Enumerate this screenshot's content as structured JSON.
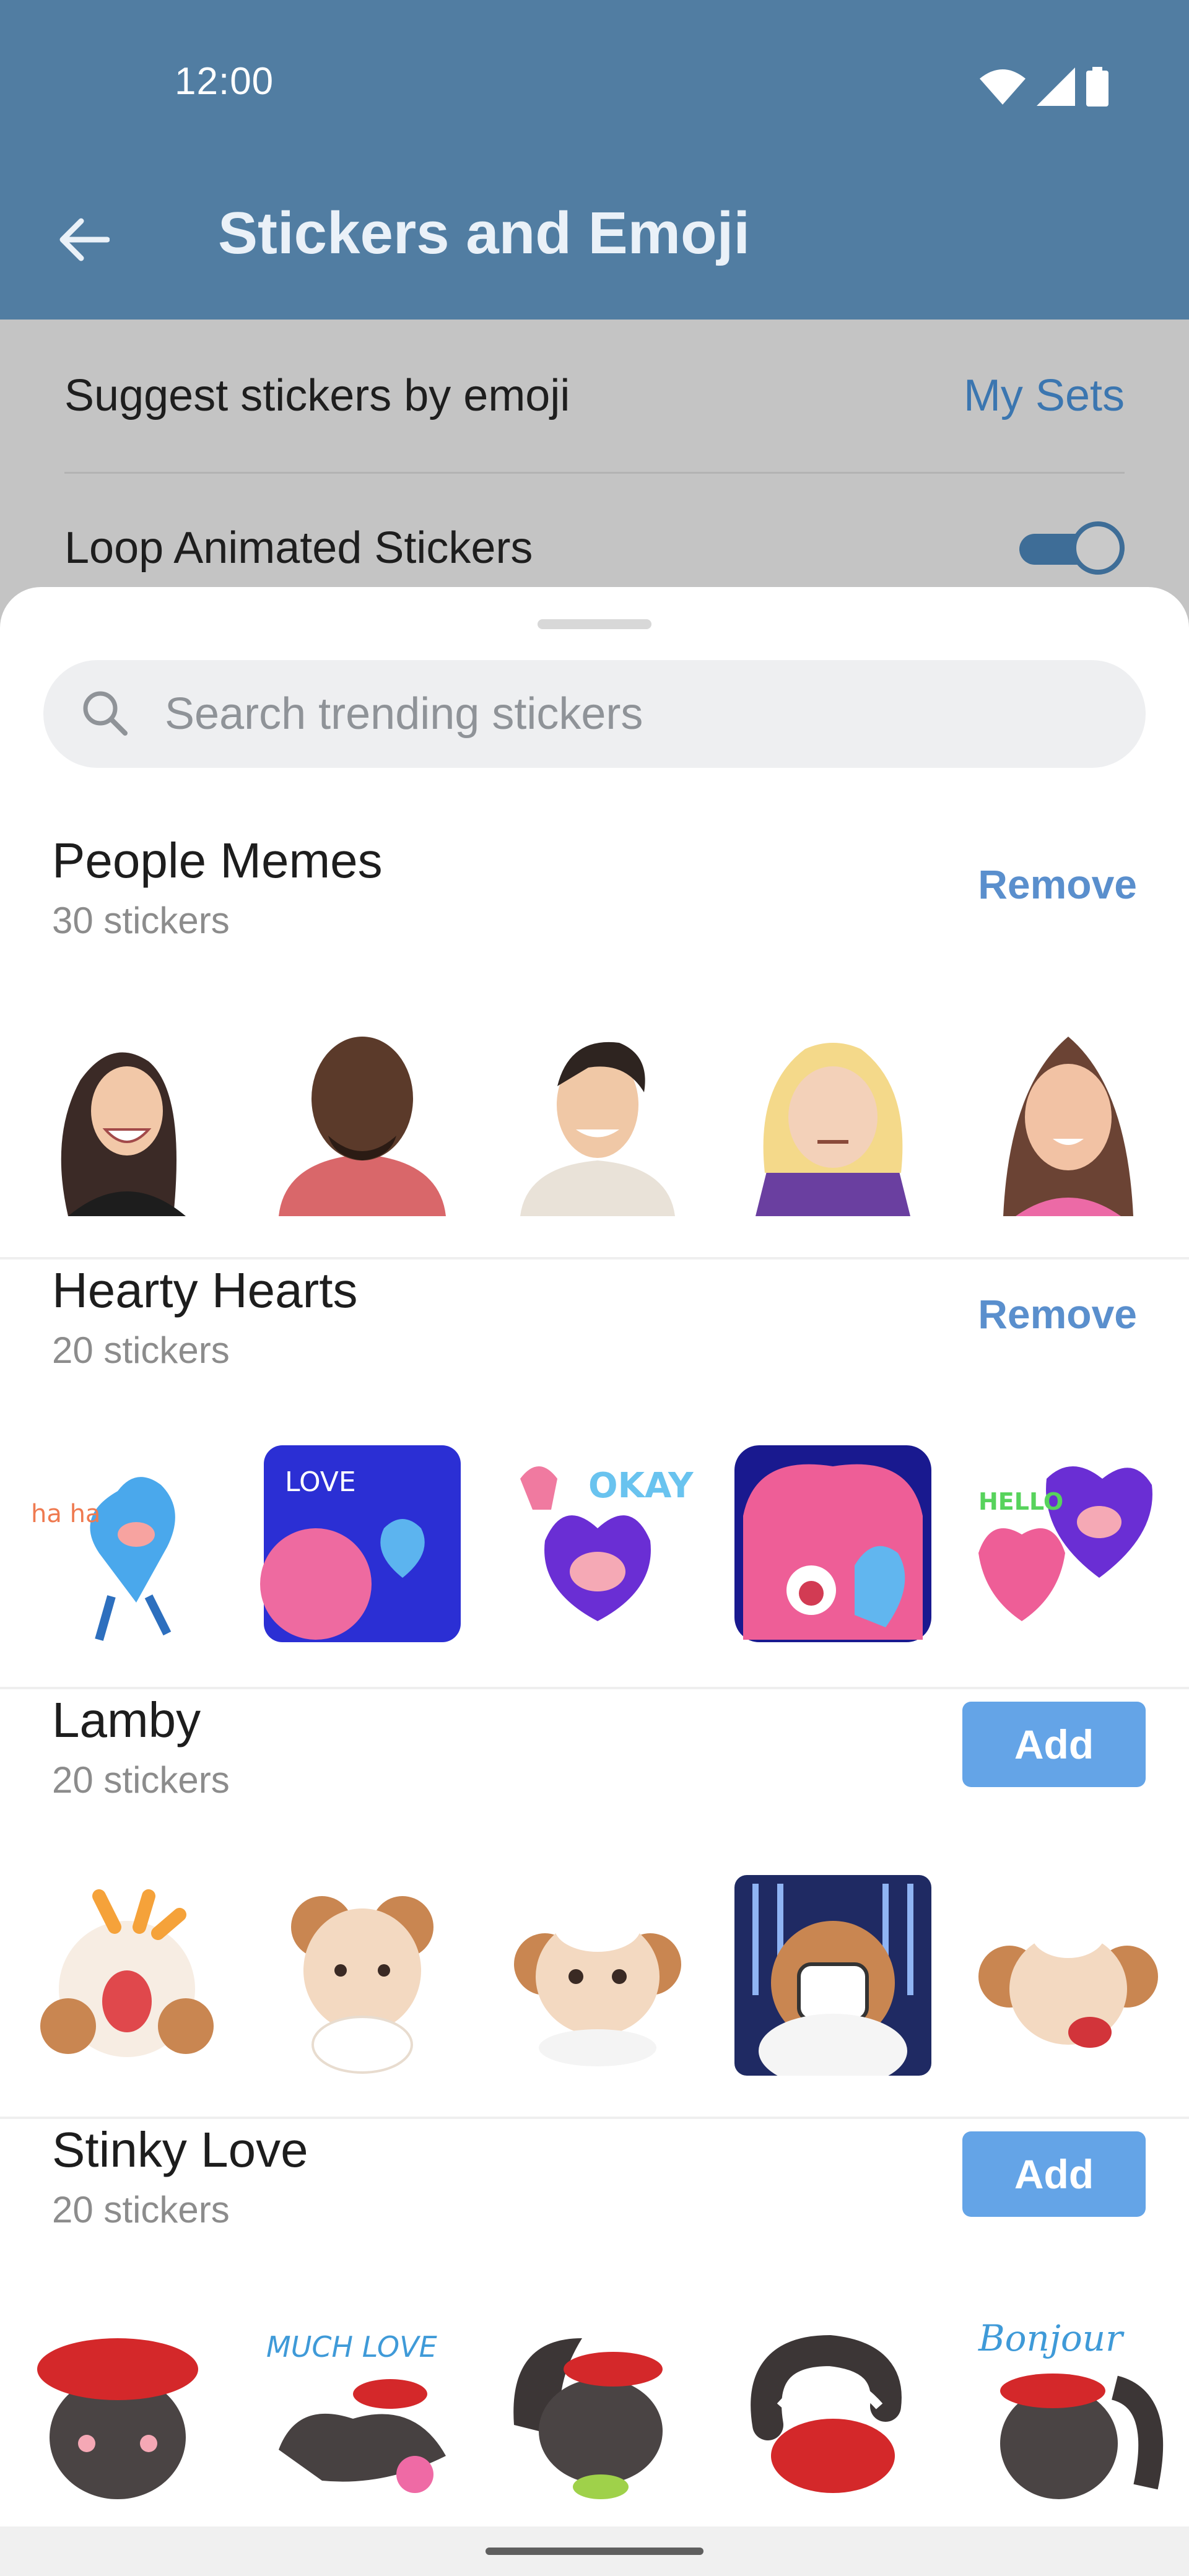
{
  "status_bar": {
    "time": "12:00",
    "icons": [
      "wifi-icon",
      "signal-icon",
      "battery-icon"
    ]
  },
  "app_bar": {
    "back_icon": "arrow-left-icon",
    "title": "Stickers and Emoji"
  },
  "settings": {
    "suggest_label": "Suggest stickers by emoji",
    "my_sets_label": "My Sets",
    "loop_label": "Loop Animated Stickers",
    "loop_enabled": true
  },
  "sheet": {
    "search_placeholder": "Search trending stickers",
    "sets": [
      {
        "title": "People Memes",
        "count": "30 stickers",
        "action": "Remove",
        "stickers": [
          "woman-laughing-sticker",
          "bald-man-sticker",
          "man-smiling-sticker",
          "blonde-girl-sticker",
          "girl-waving-sticker"
        ]
      },
      {
        "title": "Hearty Hearts",
        "count": "20 stickers",
        "action": "Remove",
        "stickers": [
          "blue-heart-laughing-sticker",
          "love-hearts-sticker",
          "okay-heart-sticker",
          "pink-heart-crying-sticker",
          "hello-hearts-sticker"
        ]
      },
      {
        "title": "Lamby",
        "count": "20 stickers",
        "action": "Add",
        "stickers": [
          "lamb-crying-sticker",
          "lamb-shy-sticker",
          "lamb-happy-sticker",
          "lamb-shocked-sticker",
          "lamb-kiss-sticker"
        ]
      },
      {
        "title": "Stinky Love",
        "count": "20 stickers",
        "action": "Add",
        "stickers": [
          "skunk-beret-sticker",
          "skunk-much-love-sticker",
          "skunk-laughing-sticker",
          "skunk-sleeping-sticker",
          "skunk-bonjour-sticker"
        ]
      }
    ],
    "sticker_text": {
      "hearts_love": "LOVE",
      "hearts_okay": "OKAY",
      "hearts_hello": "HELLO",
      "hearts_haha": "ha ha",
      "skunk_much_love": "MUCH LOVE",
      "skunk_bonjour": "Bonjour"
    }
  },
  "colors": {
    "primary": "#517da2",
    "accent_link": "#5a8fcd",
    "add_button": "#64a4e7",
    "dim_overlay": "#c4c4c4"
  }
}
